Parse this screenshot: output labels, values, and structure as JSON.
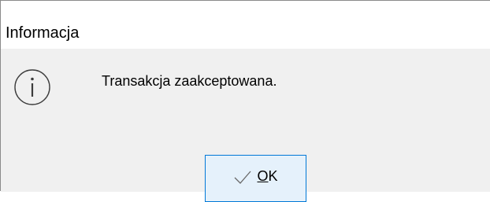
{
  "dialog": {
    "title": "Informacja",
    "icon": "info-icon",
    "message": "Transakcja zaakceptowana.",
    "ok_button": {
      "icon": "checkmark-icon",
      "mnemonic": "O",
      "rest": "K"
    }
  },
  "colors": {
    "title_bg": "#ffffff",
    "content_bg": "#f0f0f0",
    "button_bg": "#e5f1fb",
    "button_border": "#0078d7"
  }
}
